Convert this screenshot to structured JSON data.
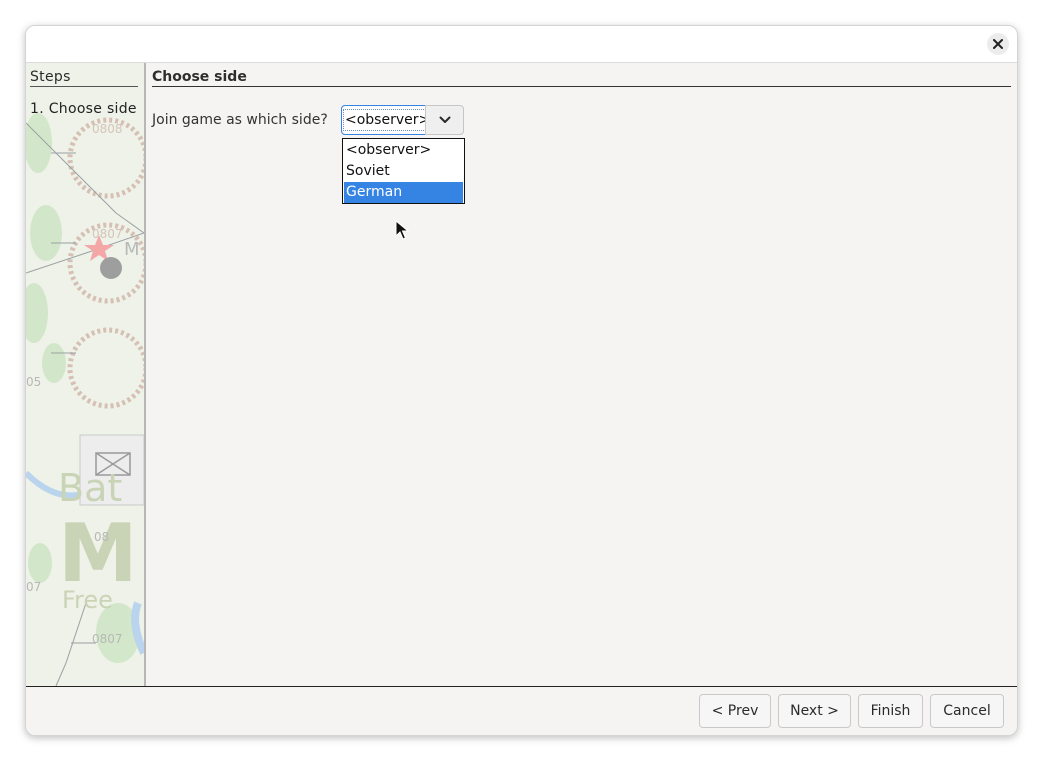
{
  "window": {
    "close_icon": "close-icon"
  },
  "steps": {
    "heading": "Steps",
    "items": [
      "1. Choose side"
    ]
  },
  "background_map": {
    "hex_labels": [
      "0807",
      "0808",
      "0807",
      "05",
      "07",
      "08"
    ],
    "overlay_text": [
      "Bat",
      "M",
      "Free"
    ]
  },
  "page": {
    "title": "Choose side",
    "prompt": "Join game as which side?"
  },
  "side_select": {
    "value": "<observer>",
    "options": [
      "<observer>",
      "Soviet",
      "German"
    ],
    "highlighted_index": 2
  },
  "buttons": {
    "prev": "< Prev",
    "next": "Next >",
    "finish": "Finish",
    "cancel": "Cancel"
  },
  "colors": {
    "accent": "#3584e4",
    "panel_bg": "#f5f4f2"
  }
}
